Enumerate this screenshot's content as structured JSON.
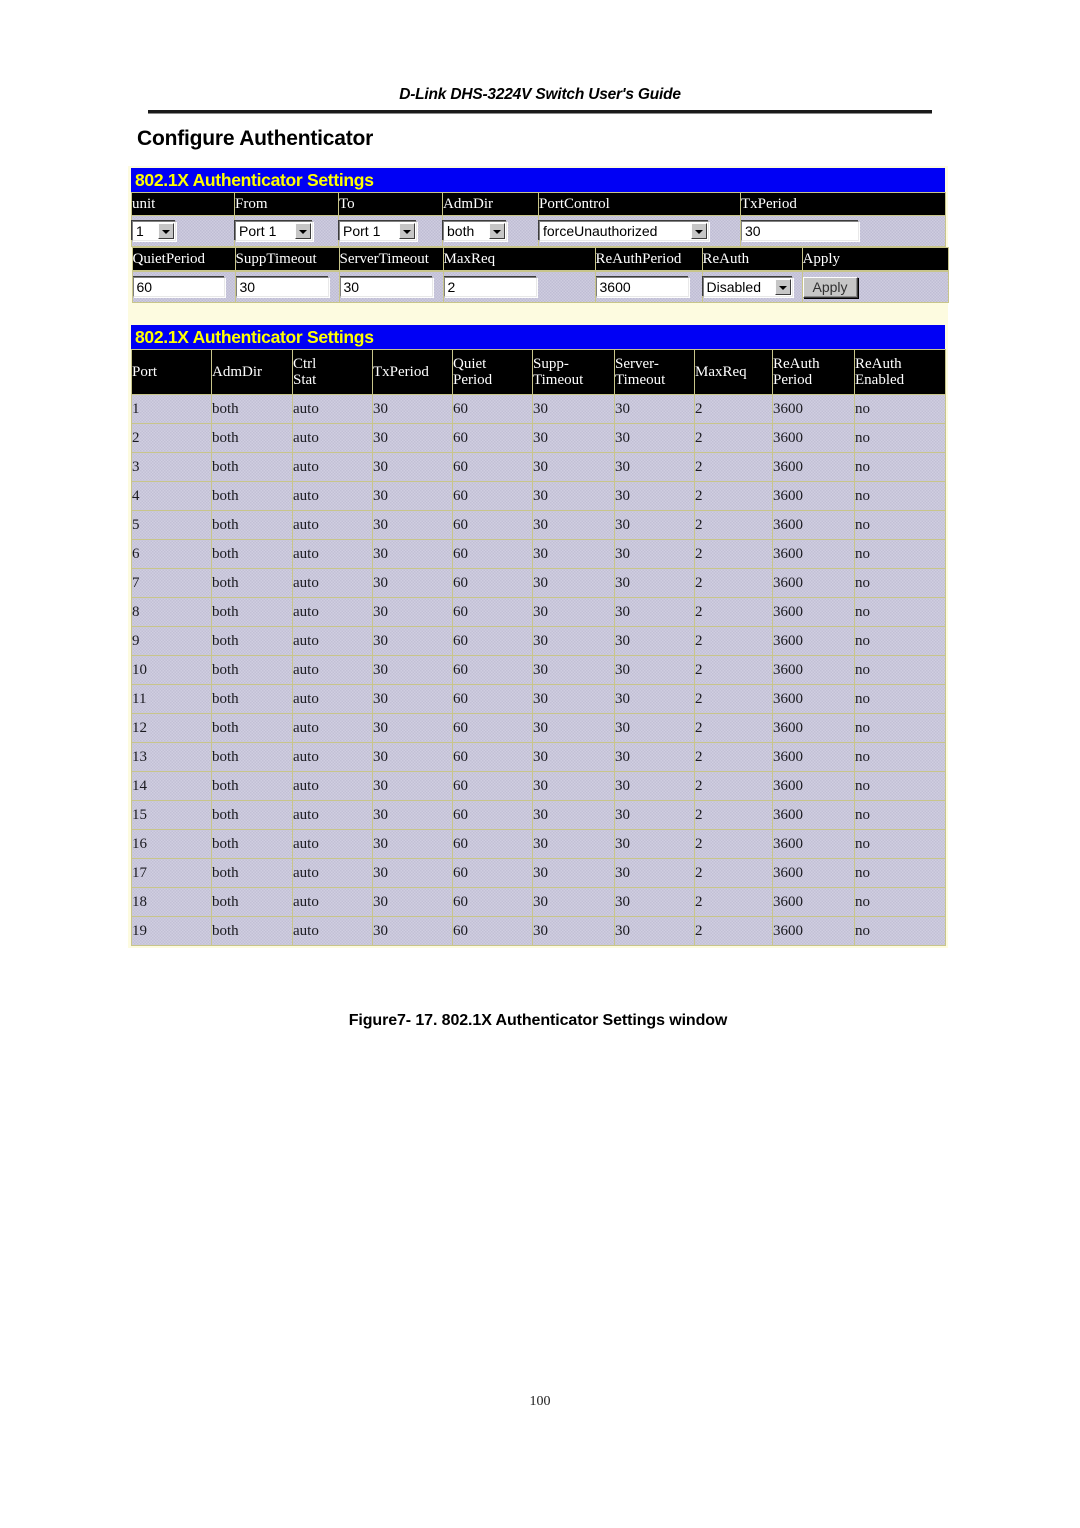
{
  "document": {
    "running_header": "D-Link DHS-3224V Switch User's Guide",
    "section_title": "Configure Authenticator",
    "figure_caption": "Figure7- 17.  802.1X Authenticator Settings window",
    "page_number": "100"
  },
  "colors": {
    "title_bar_bg": "#0000f5",
    "title_bar_text": "#ffff00",
    "header_cell_bg": "#000000",
    "header_cell_text": "#ffffff",
    "panel_bg": "#fdfbe0",
    "grid_line": "#c8c58a",
    "cell_bg": "#c9c7dc"
  },
  "settings_panel": {
    "title": "802.1X Authenticator Settings",
    "row1_headers": [
      "unit",
      "From",
      "To",
      "AdmDir",
      "PortControl",
      "TxPeriod"
    ],
    "row1_controls": [
      {
        "name": "unit",
        "type": "select",
        "value": "1"
      },
      {
        "name": "from",
        "type": "select",
        "value": "Port 1"
      },
      {
        "name": "to",
        "type": "select",
        "value": "Port 1"
      },
      {
        "name": "admdir",
        "type": "select",
        "value": "both"
      },
      {
        "name": "portcontrol",
        "type": "select",
        "value": "forceUnauthorized"
      },
      {
        "name": "txperiod",
        "type": "text",
        "value": "30"
      }
    ],
    "row2_headers": [
      "QuietPeriod",
      "SuppTimeout",
      "ServerTimeout",
      "MaxReq",
      "ReAuthPeriod",
      "ReAuth",
      "Apply"
    ],
    "row2_controls": [
      {
        "name": "quietperiod",
        "type": "text",
        "value": "60"
      },
      {
        "name": "supptimeout",
        "type": "text",
        "value": "30"
      },
      {
        "name": "servertimeout",
        "type": "text",
        "value": "30"
      },
      {
        "name": "maxreq",
        "type": "text",
        "value": "2"
      },
      {
        "name": "reauthperiod",
        "type": "text",
        "value": "3600"
      },
      {
        "name": "reauth",
        "type": "select",
        "value": "Disabled"
      },
      {
        "name": "apply",
        "type": "button",
        "value": "Apply"
      }
    ]
  },
  "table_panel": {
    "title": "802.1X Authenticator Settings",
    "columns": [
      "Port",
      "AdmDir",
      "Ctrl Stat",
      "TxPeriod",
      "Quiet Period",
      "Supp- Timeout",
      "Server- Timeout",
      "MaxReq",
      "ReAuth Period",
      "ReAuth Enabled"
    ],
    "rows": [
      [
        "1",
        "both",
        "auto",
        "30",
        "60",
        "30",
        "30",
        "2",
        "3600",
        "no"
      ],
      [
        "2",
        "both",
        "auto",
        "30",
        "60",
        "30",
        "30",
        "2",
        "3600",
        "no"
      ],
      [
        "3",
        "both",
        "auto",
        "30",
        "60",
        "30",
        "30",
        "2",
        "3600",
        "no"
      ],
      [
        "4",
        "both",
        "auto",
        "30",
        "60",
        "30",
        "30",
        "2",
        "3600",
        "no"
      ],
      [
        "5",
        "both",
        "auto",
        "30",
        "60",
        "30",
        "30",
        "2",
        "3600",
        "no"
      ],
      [
        "6",
        "both",
        "auto",
        "30",
        "60",
        "30",
        "30",
        "2",
        "3600",
        "no"
      ],
      [
        "7",
        "both",
        "auto",
        "30",
        "60",
        "30",
        "30",
        "2",
        "3600",
        "no"
      ],
      [
        "8",
        "both",
        "auto",
        "30",
        "60",
        "30",
        "30",
        "2",
        "3600",
        "no"
      ],
      [
        "9",
        "both",
        "auto",
        "30",
        "60",
        "30",
        "30",
        "2",
        "3600",
        "no"
      ],
      [
        "10",
        "both",
        "auto",
        "30",
        "60",
        "30",
        "30",
        "2",
        "3600",
        "no"
      ],
      [
        "11",
        "both",
        "auto",
        "30",
        "60",
        "30",
        "30",
        "2",
        "3600",
        "no"
      ],
      [
        "12",
        "both",
        "auto",
        "30",
        "60",
        "30",
        "30",
        "2",
        "3600",
        "no"
      ],
      [
        "13",
        "both",
        "auto",
        "30",
        "60",
        "30",
        "30",
        "2",
        "3600",
        "no"
      ],
      [
        "14",
        "both",
        "auto",
        "30",
        "60",
        "30",
        "30",
        "2",
        "3600",
        "no"
      ],
      [
        "15",
        "both",
        "auto",
        "30",
        "60",
        "30",
        "30",
        "2",
        "3600",
        "no"
      ],
      [
        "16",
        "both",
        "auto",
        "30",
        "60",
        "30",
        "30",
        "2",
        "3600",
        "no"
      ],
      [
        "17",
        "both",
        "auto",
        "30",
        "60",
        "30",
        "30",
        "2",
        "3600",
        "no"
      ],
      [
        "18",
        "both",
        "auto",
        "30",
        "60",
        "30",
        "30",
        "2",
        "3600",
        "no"
      ],
      [
        "19",
        "both",
        "auto",
        "30",
        "60",
        "30",
        "30",
        "2",
        "3600",
        "no"
      ]
    ]
  }
}
